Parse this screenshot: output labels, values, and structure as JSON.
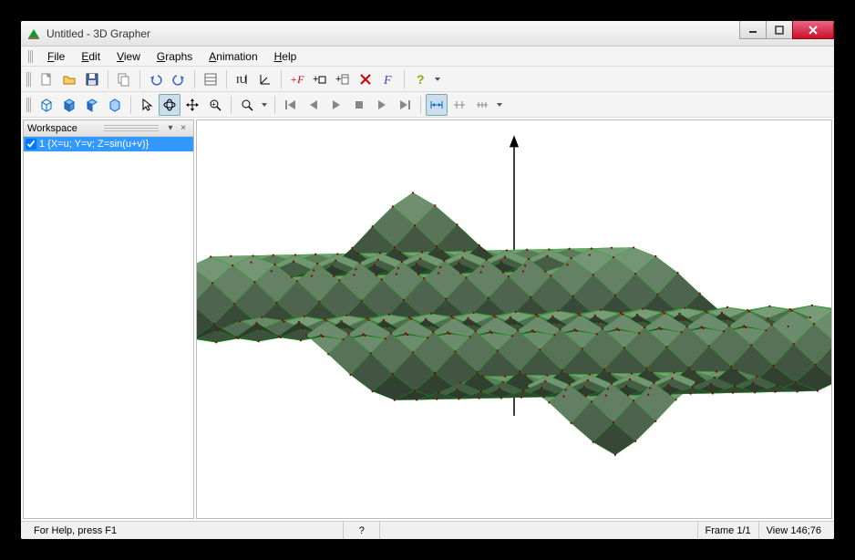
{
  "window": {
    "title": "Untitled - 3D Grapher"
  },
  "menu": {
    "file": "File",
    "edit": "Edit",
    "view": "View",
    "graphs": "Graphs",
    "animation": "Animation",
    "help": "Help"
  },
  "sidebar": {
    "title": "Workspace",
    "items": [
      {
        "checked": true,
        "label": "1 {X=u; Y=v; Z=sin(u+v)}"
      }
    ]
  },
  "statusbar": {
    "help": "For Help, press F1",
    "hint": "?",
    "frame": "Frame 1/1",
    "view": "View 146;76"
  },
  "toolbar1": {
    "new": "new",
    "open": "open",
    "save": "save",
    "copy": "copy",
    "undo": "undo",
    "redo": "redo",
    "props": "properties",
    "axes1": "axes-u",
    "axes2": "axes-l",
    "addf": "add-function",
    "addbox": "add-box",
    "addsheet": "add-sheet",
    "delete": "delete",
    "italic": "function-italic",
    "helpq": "help"
  },
  "toolbar2": {
    "cube1": "",
    "cube2": "",
    "cube3": "",
    "cube4": "",
    "arrow": "",
    "rotate": "",
    "move": "",
    "zoom": "",
    "magnify": "",
    "first": "",
    "prev": "",
    "play": "",
    "stop": "",
    "next": "",
    "last": "",
    "dim1": "",
    "dim2": "",
    "dim3": ""
  }
}
